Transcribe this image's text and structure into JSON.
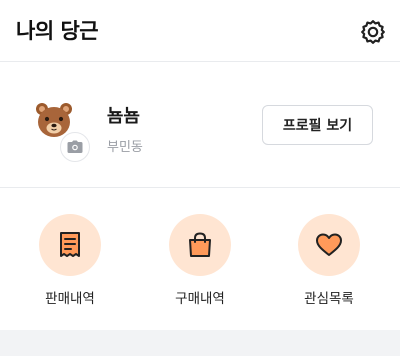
{
  "header": {
    "title": "나의 당근",
    "settings_icon": "gear-icon"
  },
  "profile": {
    "nickname": "뇸뇸",
    "location": "부민동",
    "avatar_icon": "bear-avatar-icon",
    "camera_icon": "camera-icon",
    "view_profile_label": "프로필 보기"
  },
  "menu": {
    "items": [
      {
        "label": "판매내역",
        "icon": "receipt-icon"
      },
      {
        "label": "구매내역",
        "icon": "shopping-bag-icon"
      },
      {
        "label": "관심목록",
        "icon": "heart-icon"
      }
    ]
  },
  "colors": {
    "accent": "#ff7e36",
    "accent_light": "#ffe5d2",
    "divider": "#e9ebee"
  }
}
